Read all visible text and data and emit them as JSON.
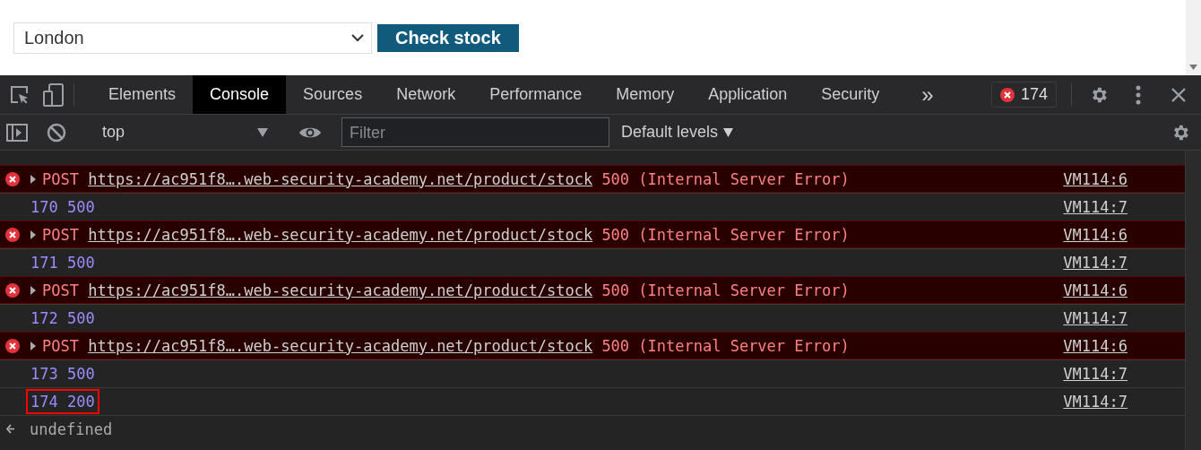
{
  "page": {
    "location_select": {
      "value": "London"
    },
    "check_button": {
      "label": "Check stock"
    }
  },
  "devtools": {
    "tabs": [
      {
        "label": "Elements",
        "selected": false
      },
      {
        "label": "Console",
        "selected": true
      },
      {
        "label": "Sources",
        "selected": false
      },
      {
        "label": "Network",
        "selected": false
      },
      {
        "label": "Performance",
        "selected": false
      },
      {
        "label": "Memory",
        "selected": false
      },
      {
        "label": "Application",
        "selected": false
      },
      {
        "label": "Security",
        "selected": false
      }
    ],
    "more_tabs": "»",
    "error_count": "174",
    "console_toolbar": {
      "context": "top",
      "filter": {
        "placeholder": "Filter"
      },
      "levels": "Default levels"
    },
    "messages": [
      {
        "kind": "error",
        "method": "POST",
        "url": "https://ac951f8….web-security-academy.net/product/stock",
        "status": "500 (Internal Server Error)",
        "source": "VM114:6",
        "highlighted": false
      },
      {
        "kind": "log",
        "text": "170 500",
        "source": "VM114:7",
        "highlighted": false
      },
      {
        "kind": "error",
        "method": "POST",
        "url": "https://ac951f8….web-security-academy.net/product/stock",
        "status": "500 (Internal Server Error)",
        "source": "VM114:6",
        "highlighted": false
      },
      {
        "kind": "log",
        "text": "171 500",
        "source": "VM114:7",
        "highlighted": false
      },
      {
        "kind": "error",
        "method": "POST",
        "url": "https://ac951f8….web-security-academy.net/product/stock",
        "status": "500 (Internal Server Error)",
        "source": "VM114:6",
        "highlighted": false
      },
      {
        "kind": "log",
        "text": "172 500",
        "source": "VM114:7",
        "highlighted": false
      },
      {
        "kind": "error",
        "method": "POST",
        "url": "https://ac951f8….web-security-academy.net/product/stock",
        "status": "500 (Internal Server Error)",
        "source": "VM114:6",
        "highlighted": false
      },
      {
        "kind": "log",
        "text": "173 500",
        "source": "VM114:7",
        "highlighted": false
      },
      {
        "kind": "log",
        "text": "174 200",
        "source": "VM114:7",
        "highlighted": true
      },
      {
        "kind": "result",
        "text": "undefined",
        "highlighted": false
      }
    ]
  }
}
